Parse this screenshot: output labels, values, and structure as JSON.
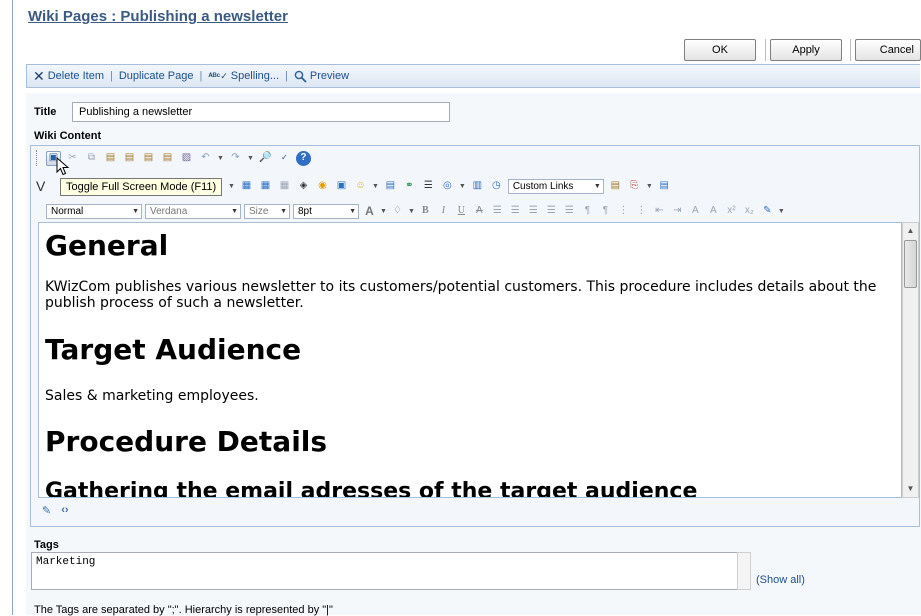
{
  "header": {
    "breadcrumb_root": "Wiki Pages",
    "breadcrumb_separator": " : ",
    "page_title": "Publishing a newsletter"
  },
  "buttons": {
    "ok": "OK",
    "apply": "Apply",
    "cancel": "Cancel"
  },
  "actions": {
    "delete": "Delete Item",
    "duplicate": "Duplicate Page",
    "spelling": "Spelling...",
    "preview": "Preview",
    "separator": "|"
  },
  "form": {
    "title_label": "Title",
    "title_value": "Publishing a newsletter",
    "wiki_content_label": "Wiki Content"
  },
  "editor": {
    "tooltip": "Toggle Full Screen Mode (F11)",
    "custom_links": "Custom Links",
    "style_select": "Normal",
    "font_select": "Verdana",
    "size_select": "Size",
    "size_value": "8pt",
    "text_a": "A",
    "text_b": "B",
    "text_i": "I",
    "text_u": "U",
    "row2_prefix": "V",
    "content": {
      "h1_general": "General",
      "p_general": "KWizCom publishes various newsletter to its customers/potential customers. This procedure includes details about the publish process of such a newsletter.",
      "h1_audience": "Target Audience",
      "p_audience": "Sales & marketing employees.",
      "h1_procedure": "Procedure Details",
      "h2_gathering": "Gathering the email adresses of the target audience"
    }
  },
  "tags": {
    "label": "Tags",
    "value": "Marketing",
    "show_all": "(Show all)",
    "note": "The Tags are separated by \";\". Hierarchy is represented by \"|\""
  },
  "colors": {
    "accent": "#3b5a82",
    "link": "#1c4f8c",
    "toolbar_bg": "#dde7f3",
    "tooltip_bg": "#ffffe1"
  }
}
